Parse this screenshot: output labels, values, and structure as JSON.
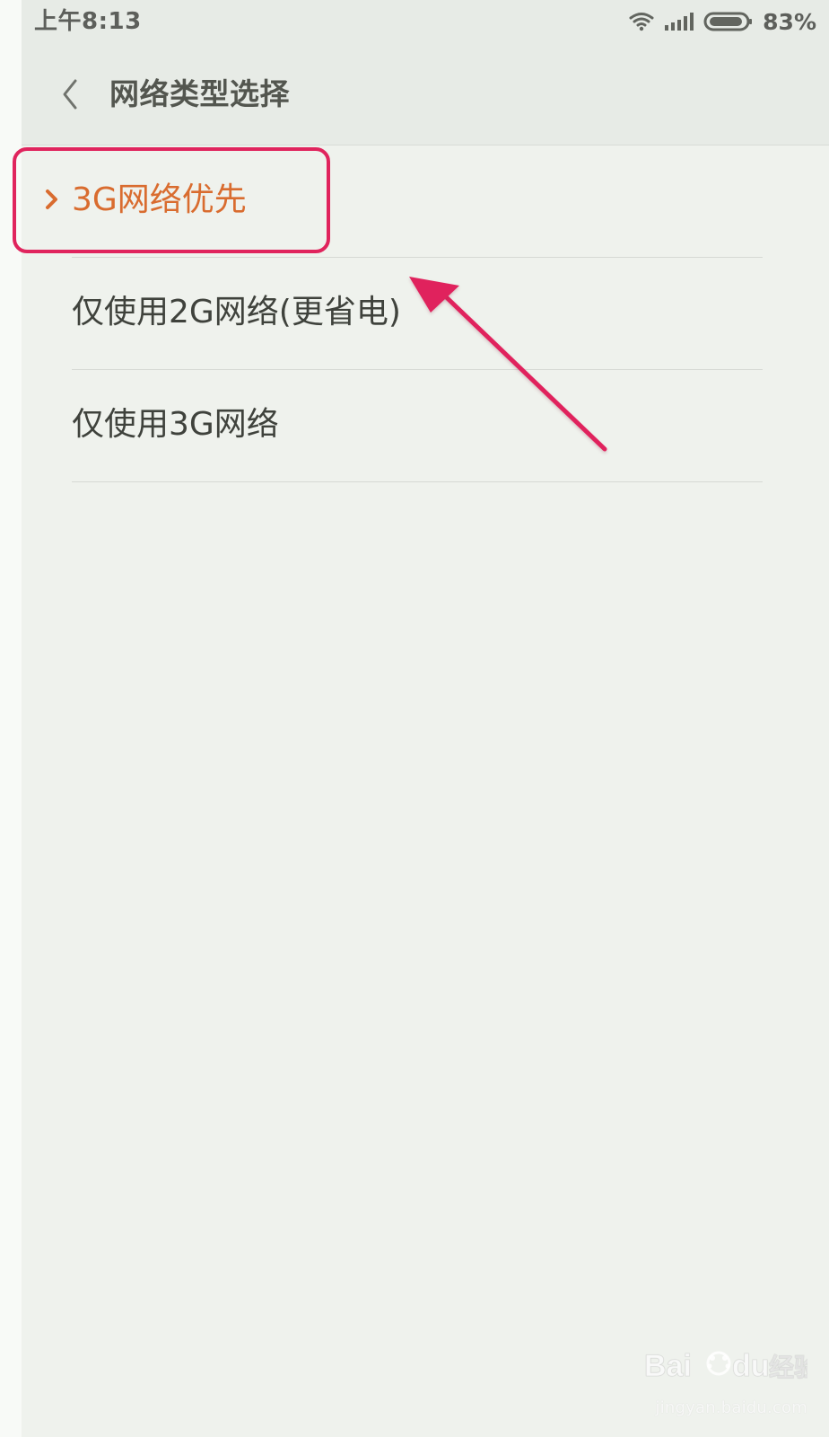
{
  "status_bar": {
    "time": "上午8:13",
    "battery_percent": "83%",
    "icons": [
      "wifi-icon",
      "signal-icon",
      "battery-icon"
    ]
  },
  "header": {
    "back_icon": "chevron-left-icon",
    "title": "网络类型选择"
  },
  "network_options": [
    {
      "label": "3G网络优先",
      "selected": true
    },
    {
      "label": "仅使用2G网络(更省电)",
      "selected": false
    },
    {
      "label": "仅使用3G网络",
      "selected": false
    }
  ],
  "watermark": {
    "brand": "Baidu经验",
    "domain": "jingyan.baidu.com"
  },
  "colors": {
    "selected_text": "#d96c2f",
    "annotation": "#e0245d",
    "background": "#eff2ed",
    "header_background": "#e7ebe6"
  }
}
